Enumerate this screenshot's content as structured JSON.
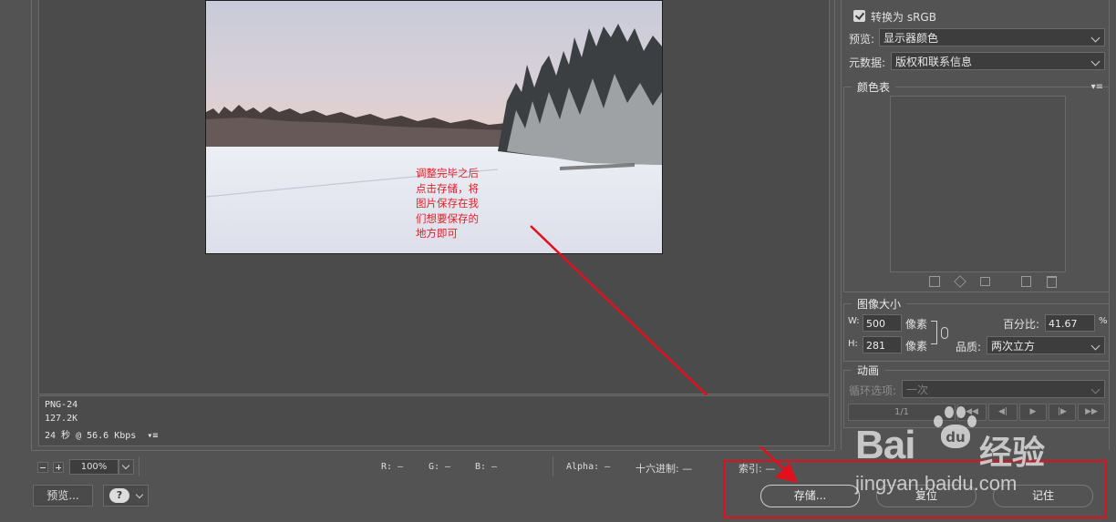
{
  "preview": {
    "note_text": "调整完毕之后点击存储，将图片保存在我们想要保存的地方即可",
    "file_format": "PNG-24",
    "file_size": "127.2K",
    "download_time": "24 秒 @ 56.6 Kbps",
    "download_menu_icon": "▾≡"
  },
  "statusbar": {
    "zoom": "100%",
    "r": "R: —",
    "g": "G: —",
    "b": "B: —",
    "alpha": "Alpha: —",
    "hex": "十六进制: —",
    "index": "索引: —"
  },
  "bottom": {
    "preview_button": "预览...",
    "browser_icon": "❓",
    "save_button": "存储...",
    "reset_button": "复位",
    "remember_button": "记住"
  },
  "settings": {
    "convert_srgb_label": "转换为 sRGB",
    "convert_srgb_checked": true,
    "preview_label": "预览:",
    "preview_value": "显示器颜色",
    "metadata_label": "元数据:",
    "metadata_value": "版权和联系信息"
  },
  "color_table": {
    "title": "颜色表",
    "menu_icon": "▾≡"
  },
  "image_size": {
    "title": "图像大小",
    "w_label": "W:",
    "w_value": "500",
    "h_label": "H:",
    "h_value": "281",
    "unit": "像素",
    "percent_label": "百分比:",
    "percent_value": "41.67",
    "percent_sign": "%",
    "quality_label": "品质:",
    "quality_value": "两次立方"
  },
  "animation": {
    "title": "动画",
    "loop_label": "循环选项:",
    "loop_value": "一次",
    "frame_counter": "1/1"
  },
  "watermark": {
    "brand_left": "Bai",
    "brand_right": "经验",
    "url": "jingyan.baidu.com"
  },
  "colors": {
    "annotation_red": "#e0101c",
    "panel_bg": "#535353"
  }
}
